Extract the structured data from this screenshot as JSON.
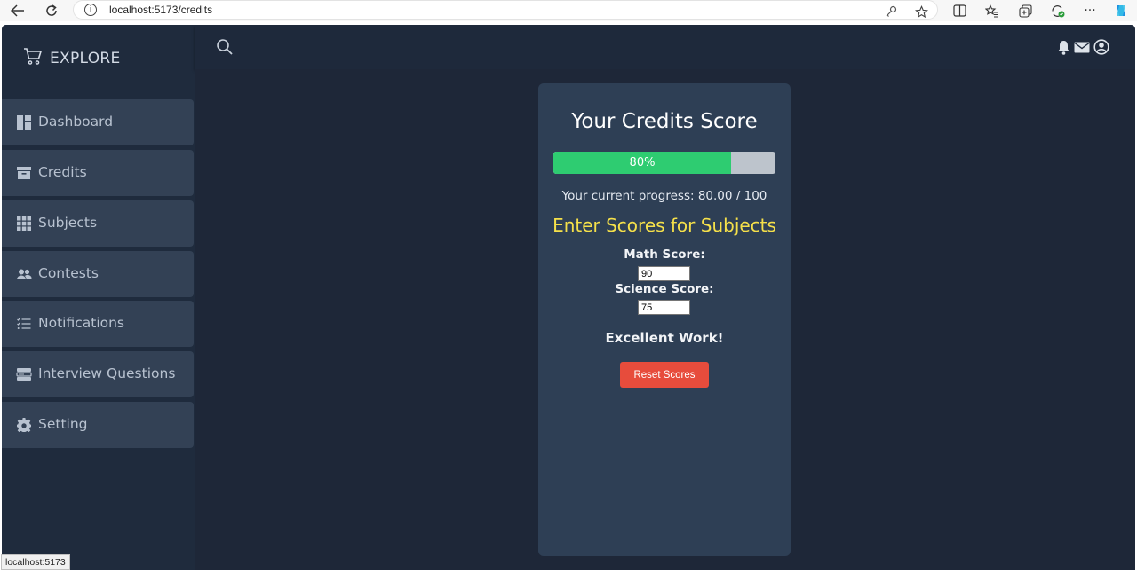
{
  "browser": {
    "url": "localhost:5173/credits",
    "info_glyph": "i",
    "icons": [
      "back-icon",
      "refresh-icon",
      "key-icon",
      "star-icon",
      "split-screen-icon",
      "favorites-icon",
      "collections-icon",
      "extensions-icon",
      "more-icon",
      "copilot-icon"
    ],
    "more_glyph": "···"
  },
  "sidebar": {
    "brand": "EXPLORE",
    "items": [
      {
        "label": "Dashboard",
        "icon": "dashboard-icon"
      },
      {
        "label": "Credits",
        "icon": "archive-icon"
      },
      {
        "label": "Subjects",
        "icon": "grid-icon"
      },
      {
        "label": "Contests",
        "icon": "users-icon"
      },
      {
        "label": "Notifications",
        "icon": "list-icon"
      },
      {
        "label": "Interview Questions",
        "icon": "server-icon"
      },
      {
        "label": "Setting",
        "icon": "gear-icon"
      }
    ]
  },
  "topbar": {
    "icons": [
      "search-icon",
      "bell-icon",
      "mail-icon",
      "user-circle-icon"
    ]
  },
  "card": {
    "title": "Your Credits Score",
    "progress_percent": 80,
    "progress_label": "80%",
    "progress_text": "Your current progress: 80.00 / 100",
    "section_title": "Enter Scores for Subjects",
    "math_label": "Math Score:",
    "math_value": "90",
    "science_label": "Science Score:",
    "science_value": "75",
    "result_message": "Excellent Work!",
    "reset_label": "Reset Scores"
  },
  "status_tooltip": "localhost:5173",
  "colors": {
    "app_bg": "#1e2738",
    "sidebar_item": "#334155",
    "card_bg": "#2e3f55",
    "progress_fill": "#2ecc71",
    "section_title": "#f5e04a",
    "reset_button": "#e74c3c"
  }
}
